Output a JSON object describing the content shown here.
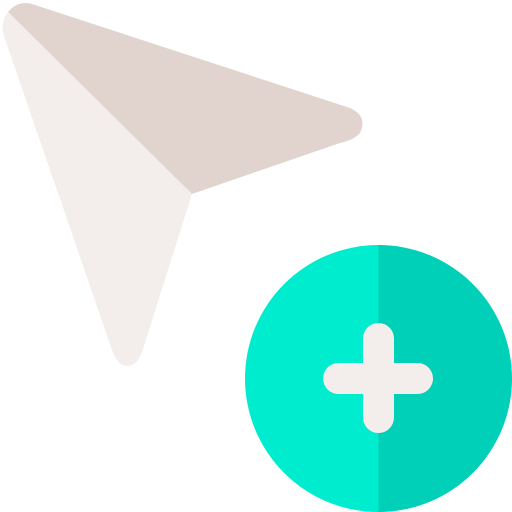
{
  "icon": {
    "name": "add-cursor",
    "parts": [
      "pointer-arrow-icon",
      "add-circle-icon",
      "plus-icon"
    ]
  },
  "colors": {
    "background": "#ffffff",
    "arrow_dark": "#e1d4cf",
    "arrow_light": "#f3eeeb",
    "circle_left": "#00ecce",
    "circle_right": "#00d0b7",
    "plus": "#f3eeeb"
  }
}
